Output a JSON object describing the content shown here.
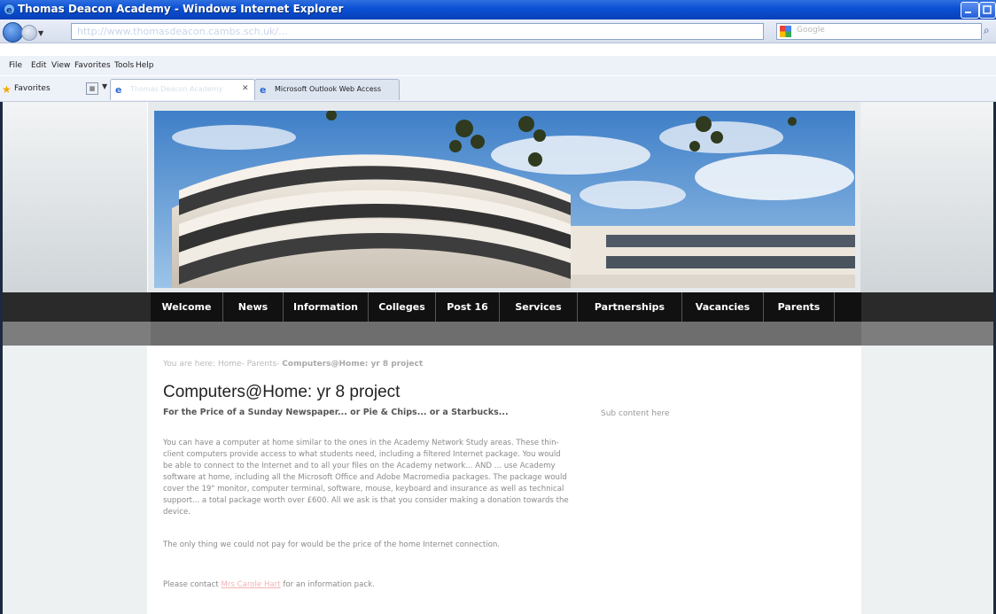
{
  "window": {
    "title": "Thomas Deacon Academy - Windows Internet Explorer",
    "accent": "#0a4fd3"
  },
  "addressbar": {
    "url": "http://www.thomasdeacon.cambs.sch.uk/...",
    "search_placeholder": "Google"
  },
  "menu": {
    "items": [
      "File",
      "Edit",
      "View",
      "Favorites",
      "Tools",
      "Help"
    ]
  },
  "favorites_bar": {
    "label": "Favorites",
    "tabs": [
      {
        "label": "Thomas Deacon Academy",
        "active": true
      },
      {
        "label": "Microsoft Outlook Web Access",
        "active": false
      }
    ]
  },
  "site_nav": {
    "items": [
      "Welcome",
      "News",
      "Information",
      "Colleges",
      "Post 16",
      "Services",
      "Partnerships",
      "Vacancies",
      "Parents"
    ]
  },
  "breadcrumb": {
    "prefix": "You are here:",
    "trail": "Home- Parents-",
    "current": "Computers@Home: yr 8 project"
  },
  "page": {
    "title": "Computers@Home: yr 8 project",
    "subheading": "For the Price of a Sunday Newspaper... or Pie & Chips... or a Starbucks...",
    "sub_content": "Sub content here",
    "paragraph1": "You can have a computer at home similar to the ones in the Academy Network Study areas. These thin-client computers provide access to what students need, including a filtered Internet package.  You would be able to connect to the Internet and to all your files on the Academy network... AND ... use Academy software at home, including all the Microsoft Office and Adobe Macromedia packages.  The package would cover the 19\" monitor, computer terminal, software, mouse, keyboard and insurance as well as technical support... a total package worth over £600. All we ask is that you consider making a donation towards the device.",
    "paragraph2": "The only thing we could not pay for would be the price of the home Internet connection.",
    "contact_prefix": "Please contact",
    "contact_link": "Mrs Carole Hart",
    "contact_suffix": "for an information pack."
  }
}
